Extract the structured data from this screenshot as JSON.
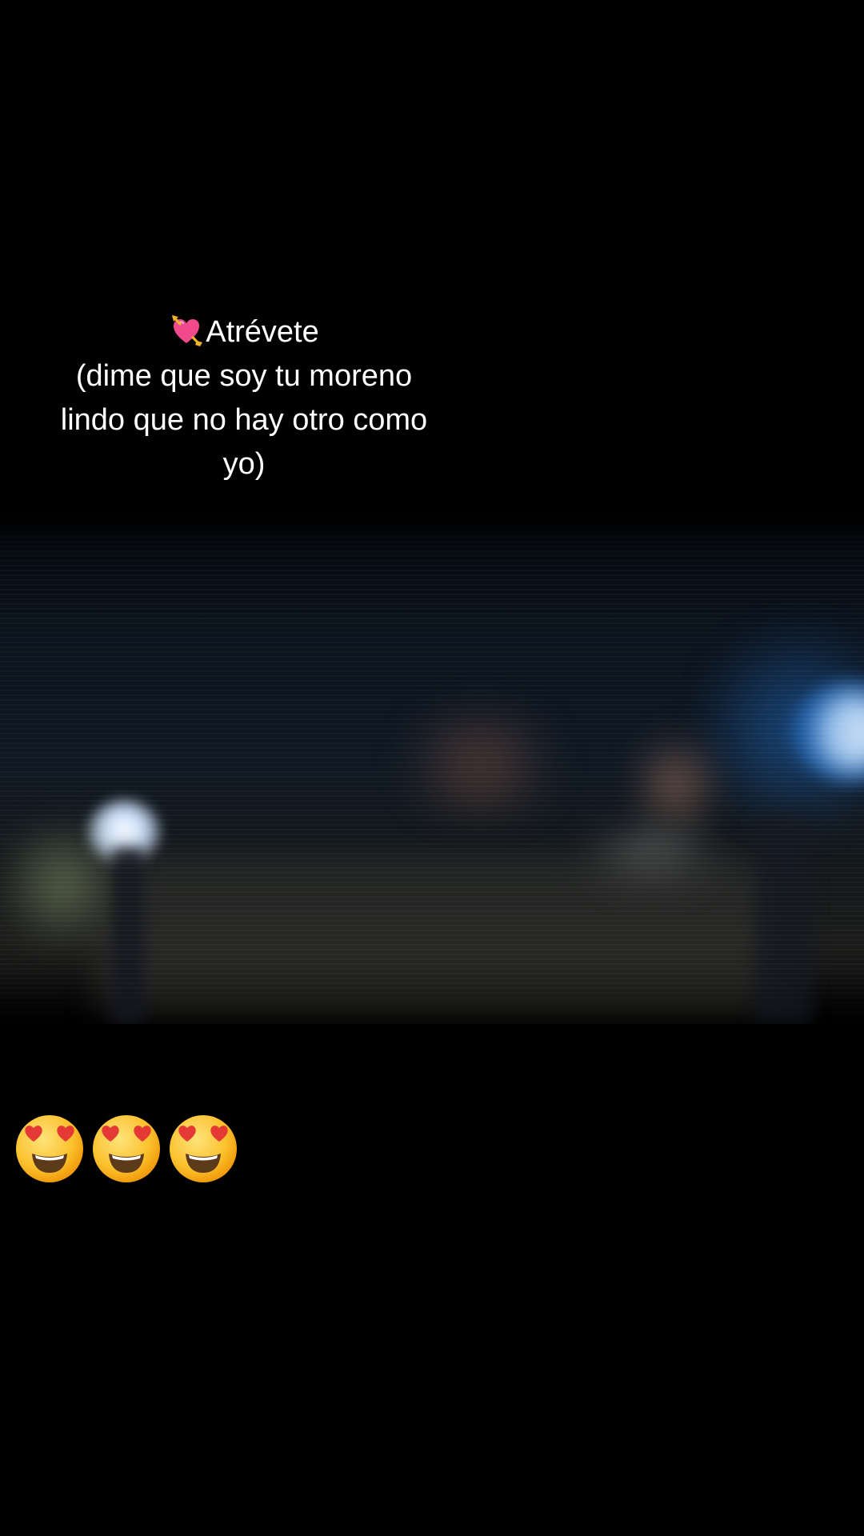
{
  "caption": {
    "lines": [
      "Atrévete",
      "(dime que soy tu moreno",
      "lindo que no hay otro como",
      "yo)"
    ],
    "leading_icon": "heart-with-arrow-icon"
  },
  "reactions": {
    "icons": [
      "heart-eyes-emoji",
      "heart-eyes-emoji",
      "heart-eyes-emoji"
    ]
  },
  "colors": {
    "background": "#000000",
    "text": "#ffffff",
    "heart_pink": "#f04a8c",
    "arrow_gold": "#f0b429",
    "emoji_face": "#fbc02d",
    "emoji_heart": "#e53935"
  }
}
